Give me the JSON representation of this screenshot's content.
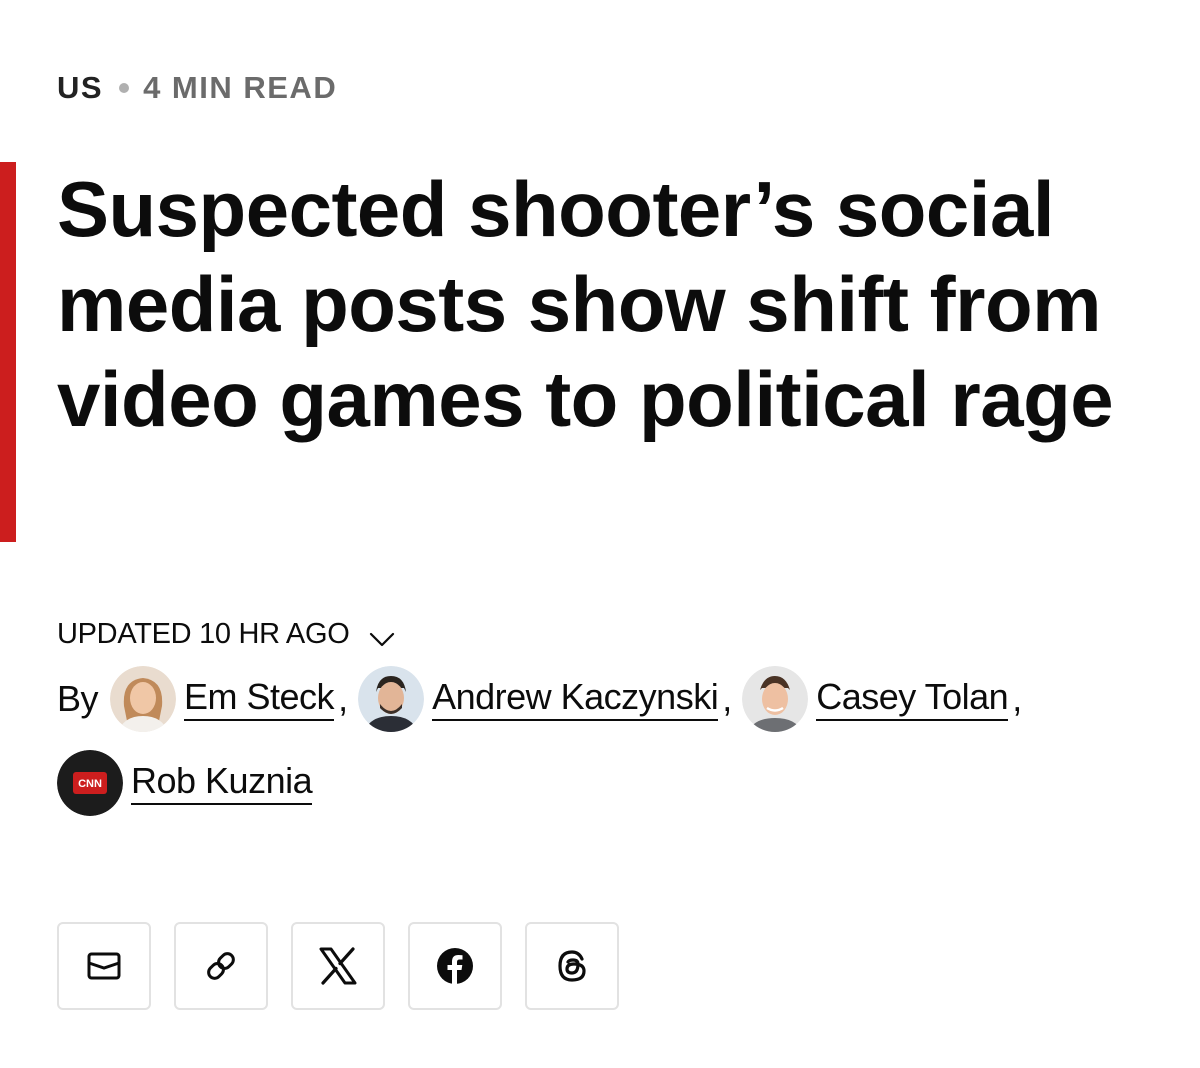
{
  "kicker": {
    "section": "US",
    "read_time": "4 MIN READ"
  },
  "headline": "Suspected shooter’s social media posts show shift from video games to political rage",
  "updated": {
    "label": "UPDATED 10 HR AGO",
    "icon": "chevron-down-icon"
  },
  "byline": {
    "prefix": "By",
    "separator": ",",
    "authors": [
      {
        "name": "Em Steck",
        "avatar": "author-photo"
      },
      {
        "name": "Andrew Kaczynski",
        "avatar": "author-photo"
      },
      {
        "name": "Casey Tolan",
        "avatar": "author-photo"
      },
      {
        "name": "Rob Kuznia",
        "avatar": "cnn-logo",
        "logo_text": "CNN"
      }
    ]
  },
  "share": {
    "buttons": [
      {
        "icon": "email-icon"
      },
      {
        "icon": "link-icon"
      },
      {
        "icon": "x-logo-icon"
      },
      {
        "icon": "facebook-icon"
      },
      {
        "icon": "threads-icon"
      }
    ]
  },
  "colors": {
    "accent": "#cc1e1e",
    "text": "#0c0c0c",
    "muted": "#6b6b6b",
    "border": "#e2e2e2"
  }
}
